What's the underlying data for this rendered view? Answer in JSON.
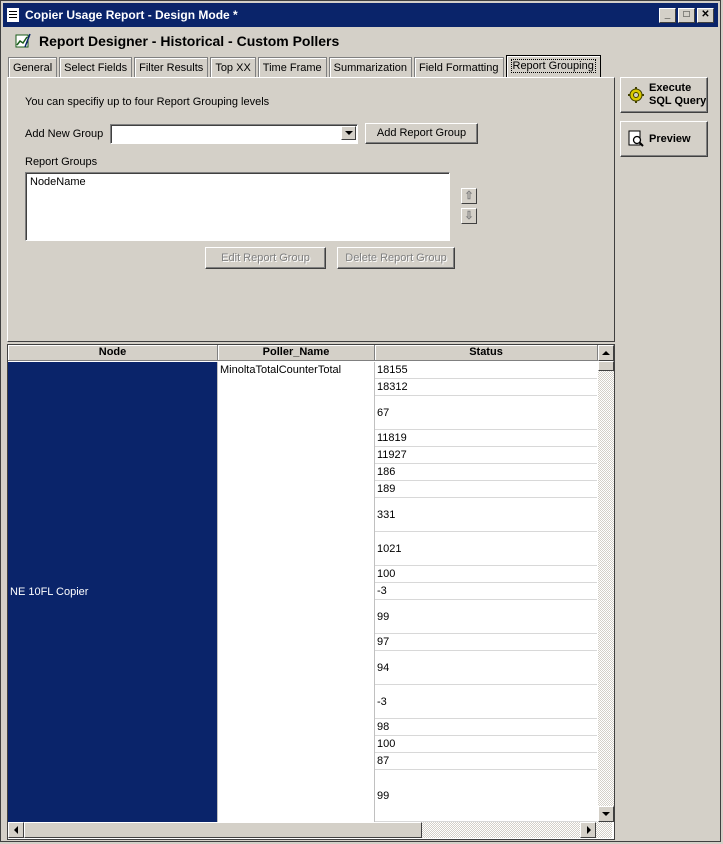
{
  "window": {
    "title": "Copier Usage Report - Design Mode *",
    "controls": [
      "_",
      "□",
      "✕"
    ]
  },
  "header": {
    "title": "Report Designer - Historical - Custom Pollers"
  },
  "tabs": [
    {
      "label": "General"
    },
    {
      "label": "Select Fields"
    },
    {
      "label": "Filter Results"
    },
    {
      "label": "Top XX"
    },
    {
      "label": "Time Frame"
    },
    {
      "label": "Summarization"
    },
    {
      "label": "Field Formatting"
    },
    {
      "label": "Report Grouping",
      "active": true
    }
  ],
  "grouping": {
    "hint": "You can specifiy up to four Report Grouping levels",
    "add_label": "Add New Group",
    "combo_value": "",
    "add_button": "Add Report Group",
    "groups_label": "Report Groups",
    "groups": [
      "NodeName"
    ],
    "move_up": "⇧",
    "move_down": "⇩",
    "edit_button": "Edit Report Group",
    "delete_button": "Delete Report Group"
  },
  "side": {
    "execute_line1": "Execute",
    "execute_line2": "SQL Query",
    "preview": "Preview"
  },
  "grid": {
    "columns": [
      "Node",
      "Poller_Name",
      "Status"
    ],
    "node": "NE 10FL Copier",
    "poller": "MinoltaTotalCounterTotal",
    "status": [
      "18155",
      "18312",
      "67",
      "11819",
      "11927",
      "186",
      "189",
      "331",
      "1021",
      "100",
      "-3",
      "99",
      "97",
      "94",
      "-3",
      "98",
      "100",
      "87",
      "99"
    ]
  },
  "colors": {
    "titlebar": "#0a246a",
    "selection": "#0a246a",
    "face": "#d4d0c8"
  }
}
